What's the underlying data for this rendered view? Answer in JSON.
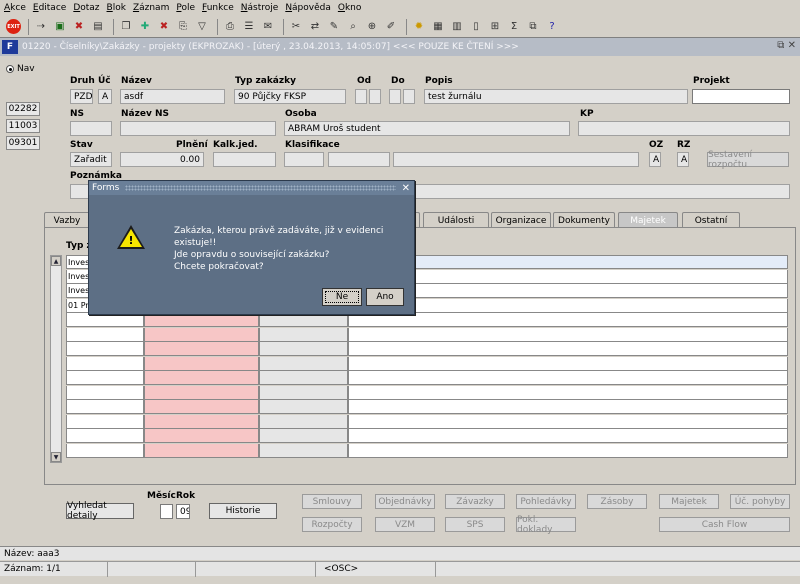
{
  "menu": [
    "Akce",
    "Editace",
    "Dotaz",
    "Blok",
    "Záznam",
    "Pole",
    "Funkce",
    "Nástroje",
    "Nápověda",
    "Okno"
  ],
  "window": {
    "title": "01220 - Číselníky\\Zakázky - projekty (EKPROZAK) - [úterý , 23.04.2013, 14:05:07] <<< POUZE KE ČTENÍ >>>"
  },
  "nav": {
    "radio_label": "Nav",
    "items": [
      "02282",
      "11003",
      "09301"
    ]
  },
  "form": {
    "druh_label": "Druh",
    "druh": "PZD",
    "uc_label": "Úč",
    "uc": "A",
    "nazev_label": "Název",
    "nazev": "asdf",
    "typ_label": "Typ zakázky",
    "typ": "90 Půjčky FKSP",
    "od_label": "Od",
    "do_label": "Do",
    "popis_label": "Popis",
    "popis": "test žurnálu",
    "projekt_label": "Projekt",
    "ns_label": "NS",
    "nazev_ns_label": "Název NS",
    "osoba_label": "Osoba",
    "osoba": "ABRAM Uroš  student",
    "kp_label": "KP",
    "stav_label": "Stav",
    "stav": "Zařadit",
    "plneni_label": "Plnění",
    "plneni": "0.00",
    "kalk_label": "Kalk.jed.",
    "klasif_label": "Klasifikace",
    "oz_label": "OZ",
    "oz": "A",
    "rz_label": "RZ",
    "rz": "A",
    "sestaveni": "Sestavení rozpočtu",
    "poznamka_label": "Poznámka"
  },
  "tabs": [
    "Vazby",
    "Události",
    "Organizace",
    "Dokumenty",
    "Majetek",
    "Ostatní"
  ],
  "grid": {
    "header": "Typ z",
    "rows": [
      "Inves",
      "Inves",
      "Inves",
      "01 Pr"
    ]
  },
  "bottom": {
    "vyhledat": "Vyhledat detaily",
    "mesic_label": "Měsíc",
    "rok_label": "Rok",
    "rok": "09",
    "historie": "Historie",
    "buttons_row1": [
      "Smlouvy",
      "Objednávky",
      "Závazky",
      "Pohledávky",
      "Zásoby",
      "Majetek",
      "Úč. pohyby"
    ],
    "buttons_row2": [
      "Rozpočty",
      "VZM",
      "SPS",
      "Pokl. doklady",
      "Cash Flow"
    ]
  },
  "status": {
    "line1": "Název: aaa3",
    "record": "Záznam: 1/1",
    "osc": "<OSC>"
  },
  "dialog": {
    "title": "Forms",
    "lines": [
      "Zakázka, kterou právě zadáváte, již v evidenci existuje!!",
      "Jde opravdu o související zakázku?",
      "Chcete pokračovat?"
    ],
    "no": "Ne",
    "yes": "Ano"
  }
}
